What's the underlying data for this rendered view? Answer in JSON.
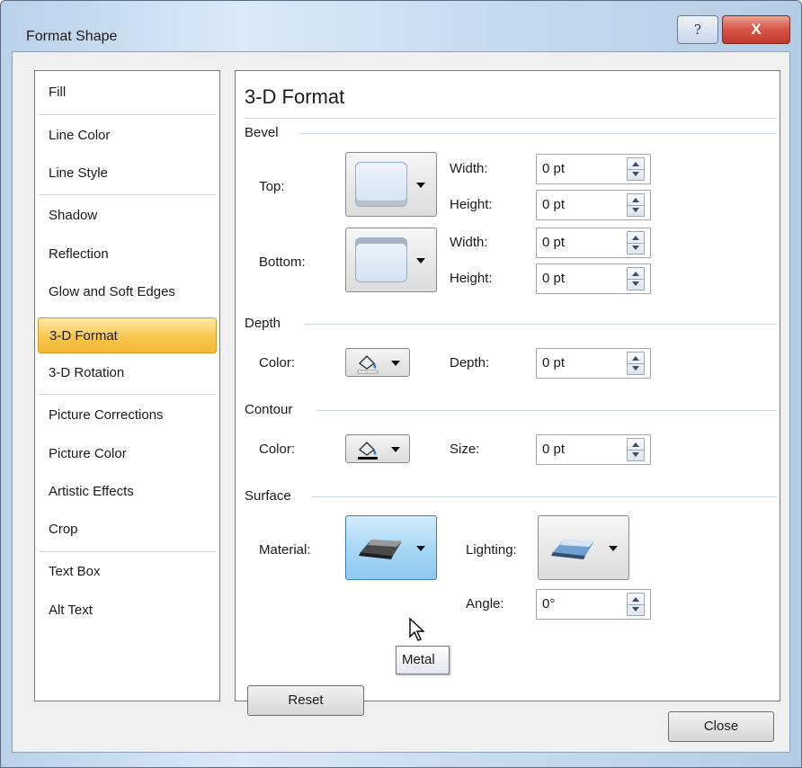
{
  "window": {
    "title": "Format Shape",
    "help_label": "?",
    "close_label": "X"
  },
  "nav": {
    "items": [
      {
        "label": "Fill",
        "selected": false
      },
      {
        "label": "Line Color",
        "selected": false
      },
      {
        "label": "Line Style",
        "selected": false
      },
      {
        "label": "Shadow",
        "selected": false
      },
      {
        "label": "Reflection",
        "selected": false
      },
      {
        "label": "Glow and Soft Edges",
        "selected": false
      },
      {
        "label": "3-D Format",
        "selected": true
      },
      {
        "label": "3-D Rotation",
        "selected": false
      },
      {
        "label": "Picture Corrections",
        "selected": false
      },
      {
        "label": "Picture Color",
        "selected": false
      },
      {
        "label": "Artistic Effects",
        "selected": false
      },
      {
        "label": "Crop",
        "selected": false
      },
      {
        "label": "Text Box",
        "selected": false
      },
      {
        "label": "Alt Text",
        "selected": false
      }
    ]
  },
  "panel": {
    "title": "3-D Format",
    "bevel": {
      "heading": "Bevel",
      "top_label": "Top:",
      "bottom_label": "Bottom:",
      "top_width_label": "Width:",
      "top_width_value": "0 pt",
      "top_height_label": "Height:",
      "top_height_value": "0 pt",
      "bottom_width_label": "Width:",
      "bottom_width_value": "0 pt",
      "bottom_height_label": "Height:",
      "bottom_height_value": "0 pt"
    },
    "depth": {
      "heading": "Depth",
      "color_label": "Color:",
      "depth_label": "Depth:",
      "depth_value": "0 pt"
    },
    "contour": {
      "heading": "Contour",
      "color_label": "Color:",
      "size_label": "Size:",
      "size_value": "0 pt"
    },
    "surface": {
      "heading": "Surface",
      "material_label": "Material:",
      "lighting_label": "Lighting:",
      "angle_label": "Angle:",
      "angle_value": "0°",
      "tooltip": "Metal"
    },
    "reset_label": "Reset"
  },
  "footer": {
    "close_label": "Close"
  },
  "colors": {
    "selected_item": "#f7c64d",
    "hover_button": "#a9d8f6",
    "close_x": "#c13a2c"
  }
}
